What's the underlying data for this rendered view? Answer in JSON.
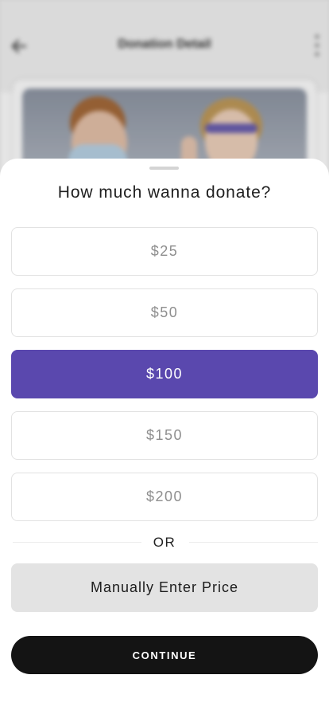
{
  "background": {
    "title": "Donation Detail",
    "back_icon": "arrow-left-icon",
    "menu_icon": "more-vertical-icon"
  },
  "sheet": {
    "title": "How much wanna donate?",
    "amounts": [
      {
        "label": "$25",
        "selected": false
      },
      {
        "label": "$50",
        "selected": false
      },
      {
        "label": "$100",
        "selected": true
      },
      {
        "label": "$150",
        "selected": false
      },
      {
        "label": "$200",
        "selected": false
      }
    ],
    "or_label": "OR",
    "manual_label": "Manually Enter Price",
    "continue_label": "CONTINUE"
  },
  "colors": {
    "accent": "#5a48ae",
    "primary_button": "#141414",
    "secondary_button": "#e3e3e3"
  }
}
